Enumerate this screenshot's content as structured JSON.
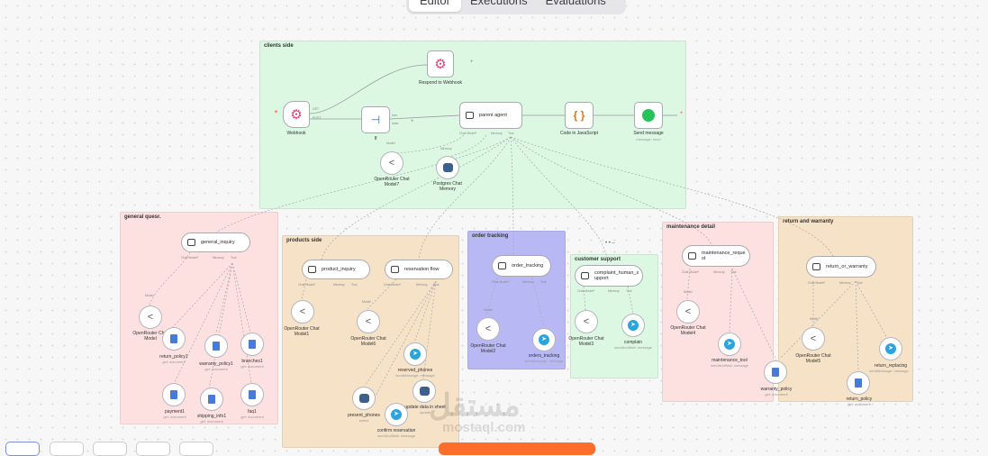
{
  "tabs": [
    "Editor",
    "Executions",
    "Evaluations"
  ],
  "groups": {
    "clients": "clients side",
    "general": "general quesr.",
    "products": "products side",
    "order": "order tracking",
    "support": "customer support",
    "maintenance": "maintenance detail",
    "warranty": "return and warranty"
  },
  "colors": {
    "clients": "#dcf8e2",
    "general": "#fde1e1",
    "products": "#f6e2c7",
    "order": "#b8b8f4",
    "support": "#dcf8e2",
    "maintenance": "#fde1e1",
    "warranty": "#f6e2c7",
    "accent_orange": "#ff6d2d"
  },
  "nodes": {
    "respond_webhook": "Respond to Webhook",
    "webhook": "Webhook",
    "webhook_get": "GET",
    "webhook_post": "POST",
    "if_label": "If",
    "if_true": "true",
    "if_false": "false",
    "parent_agent": "parent agent",
    "code": "Code in JavaScript",
    "send_message": "Send message",
    "send_message_sub": "message: send",
    "or_model7": "OpenRouter Chat Model7",
    "pg_memory": "Postgres Chat Memory",
    "general_inquiry": "general_inquiry",
    "or_model": "OpenRouter Chat Model",
    "return_policy1": "return_policy1",
    "return_policy1_sub": "get: document",
    "warranty_policy1": "warranty_policy1",
    "warranty_policy1_sub": "get: document",
    "branches1": "branches1",
    "branches1_sub": "get: document",
    "payment1": "payment1",
    "payment1_sub": "get: document",
    "shipping_info1": "shipping_info1",
    "shipping_info1_sub": "get: document",
    "faq1": "faq1",
    "faq1_sub": "get: document",
    "product_inquiry": "product_inquiry",
    "reservation_flow": "reservation flow",
    "or_model1": "OpenRouter Chat Model1",
    "or_model6": "OpenRouter Chat Model6",
    "reserved_phones": "reserved_phones",
    "reserved_phones_sub": "sendMessage: message",
    "update_data": "update data in sheet",
    "update_data_sub": "update",
    "present_phones": "present_phones",
    "present_phones_sub": "select",
    "confirm_reservation": "confirm reservation",
    "confirm_reservation_sub": "sendAndWait: message",
    "order_tracking": "order_tracking",
    "or_model2": "OpenRouter Chat Model2",
    "orders_tracking": "orders_tracking",
    "orders_tracking_sub": "sendMessage: message",
    "complaint": "complaint_human_s upport",
    "or_model3": "OpenRouter Chat Model3",
    "complain": "complain",
    "complain_sub": "sendAndWait: message",
    "maintenance_request": "maintenance_reque st",
    "or_model4": "OpenRouter Chat Model4",
    "maintenance_tool": "maintenance_tool",
    "maintenance_tool_sub": "sendAndWait: message",
    "return_or_warranty": "return_or_warranty",
    "or_model5": "OpenRouter Chat Model5",
    "return_replacing": "return_replacing",
    "return_replacing_sub": "sendMessage: message",
    "warranty_policy": "warranty_policy",
    "warranty_policy_sub": "get: document",
    "return_policy": "return_policy",
    "return_policy_sub": "get: document"
  },
  "ports": {
    "chat_model": "Chat Model*",
    "memory": "Memory",
    "tool": "Tool",
    "model": "Model"
  },
  "watermark": {
    "arabic": "مستقل",
    "latin": "mostaql.com"
  }
}
